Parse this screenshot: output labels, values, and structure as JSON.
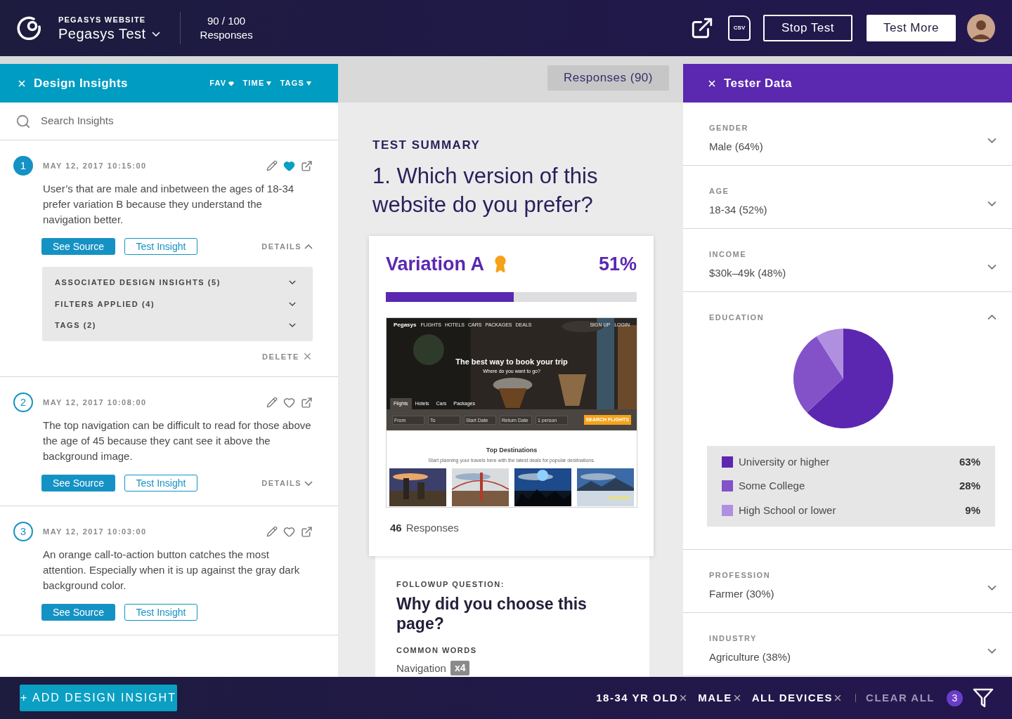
{
  "header": {
    "project_label": "PEGASYS WEBSITE",
    "project_name": "Pegasys Test",
    "responses_count": "90 / 100",
    "responses_label": "Responses",
    "csv_label": "CSV",
    "buttons": [
      {
        "label": "Stop Test",
        "kind": "outline"
      },
      {
        "label": "Test More",
        "kind": "solid"
      }
    ]
  },
  "insights_panel": {
    "title": "Design Insights",
    "filters": [
      {
        "label": "FAV",
        "kind": "heart"
      },
      {
        "label": "TIME",
        "kind": "caret"
      },
      {
        "label": "TAGS",
        "kind": "caret"
      }
    ],
    "search": {
      "placeholder": "Search Insights"
    },
    "insights": [
      {
        "number": "1",
        "selected": true,
        "date": "MAY 12, 2017 10:15:00",
        "favorite": true,
        "text": "User’s that are male and inbetween the ages of 18-34 prefer variation B because they understand the navigation better.",
        "buttons": [
          "See Source",
          "Test Insight"
        ],
        "details": {
          "label": "DETAILS",
          "expanded": true,
          "sections": [
            "ASSOCIATED DESIGN INSIGHTS (5)",
            "FILTERS APPLIED (4)",
            "TAGS (2)"
          ],
          "delete": "DELETE"
        }
      },
      {
        "number": "2",
        "selected": false,
        "date": "MAY 12, 2017 10:08:00",
        "favorite": false,
        "text": "The top navigation can be difficult to read for those above the age of 45 because they cant see it above the background image.",
        "buttons": [
          "See Source",
          "Test Insight"
        ],
        "details": {
          "label": "DETAILS",
          "expanded": false
        }
      },
      {
        "number": "3",
        "selected": false,
        "date": "MAY 12, 2017 10:03:00",
        "favorite": false,
        "text": "An orange call-to-action button catches the most attention. Especially when it is up against the gray dark background color.",
        "buttons": [
          "See Source",
          "Test Insight"
        ]
      }
    ]
  },
  "responses_tab": "Responses (90)",
  "summary": {
    "label": "TEST SUMMARY",
    "question": "1. Which version of this website do you prefer?"
  },
  "variation": {
    "name": "Variation A",
    "winner": true,
    "percent": "51%",
    "level": 0.51,
    "responses_count": "46",
    "responses_label": "Responses",
    "preview": {
      "brand": "Pegasys",
      "nav": [
        "FLIGHTS",
        "HOTELS",
        "CARS",
        "PACKAGES",
        "DEALS"
      ],
      "account": [
        "SIGN UP",
        "LOGIN"
      ],
      "headline": "The best way to book your trip",
      "subheadline": "Where do you want to go?",
      "tabs": [
        {
          "label": "Flights",
          "selected": true
        },
        {
          "label": "Hotels",
          "selected": false
        },
        {
          "label": "Cars",
          "selected": false
        },
        {
          "label": "Packages",
          "selected": false
        }
      ],
      "fields": [
        {
          "placeholder": "From"
        },
        {
          "placeholder": "To"
        },
        {
          "placeholder": "Start Date"
        },
        {
          "placeholder": "Return Date"
        },
        {
          "placeholder": "1 person"
        }
      ],
      "search_button": "SEARCH FLIGHTS",
      "section_title": "Top Destinations",
      "section_subtitle": "Start planning your travels here with the latest deals for popular destinations.",
      "destinations": [
        {
          "kind": "picture"
        },
        {
          "kind": "picture"
        },
        {
          "kind": "picture"
        },
        {
          "kind": "picture"
        }
      ]
    }
  },
  "followup": {
    "label": "FOLLOWUP QUESTION:",
    "question": "Why did you choose this page?",
    "common_words_label": "COMMON WORDS",
    "words": [
      {
        "word": "Navigation",
        "count": "x4"
      }
    ]
  },
  "tester_data": {
    "title": "Tester Data",
    "sections": [
      {
        "label": "GENDER",
        "value": "Male (64%)",
        "expanded": false
      },
      {
        "label": "AGE",
        "value": "18-34 (52%)",
        "expanded": false
      },
      {
        "label": "INCOME",
        "value": "$30k–49k (48%)",
        "expanded": false
      },
      {
        "label": "EDUCATION",
        "expanded": true,
        "chart_data": {
          "type": "pie",
          "categories": [
            "University or higher",
            "Some College",
            "High School or lower"
          ],
          "values": [
            63,
            28,
            9
          ]
        },
        "legend": [
          {
            "value": "63%",
            "color": "#5b27b0"
          },
          {
            "value": "28%",
            "color": "#8352c8"
          },
          {
            "value": "9%",
            "color": "#b08ee0"
          }
        ]
      },
      {
        "label": "PROFESSION",
        "value": "Farmer (30%)",
        "expanded": false
      },
      {
        "label": "INDUSTRY",
        "value": "Agriculture (38%)",
        "expanded": false
      }
    ]
  },
  "footer": {
    "add_button": "+ ADD DESIGN INSIGHT",
    "filters": [
      "18-34 YR OLD",
      "MALE",
      "ALL DEVICES"
    ],
    "clear_all": "CLEAR ALL",
    "filter_count": "3"
  }
}
